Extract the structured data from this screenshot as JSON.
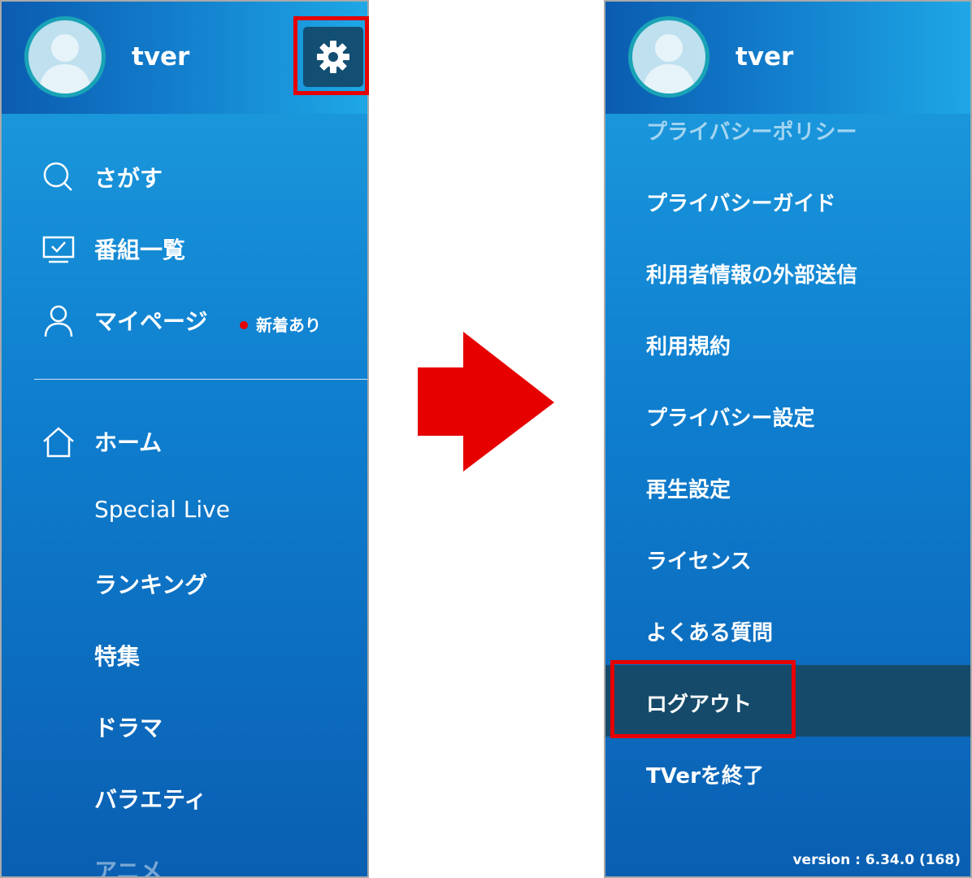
{
  "left": {
    "username": "tver",
    "settings_icon": "gear-icon",
    "nav_items": [
      {
        "label": "さがす",
        "icon": "search-icon"
      },
      {
        "label": "番組一覧",
        "icon": "tv-icon"
      },
      {
        "label": "マイページ",
        "icon": "person-icon",
        "badge": "新着あり"
      }
    ],
    "home": {
      "label": "ホーム",
      "icon": "home-icon"
    },
    "sub_items": [
      "Special Live",
      "ランキング",
      "特集",
      "ドラマ",
      "バラエティ",
      "アニメ"
    ]
  },
  "right": {
    "username": "tver",
    "menu_items": [
      "プライバシーポリシー",
      "プライバシーガイド",
      "利用者情報の外部送信",
      "利用規約",
      "プライバシー設定",
      "再生設定",
      "ライセンス",
      "よくある質問",
      "ログアウト",
      "TVerを終了"
    ],
    "highlighted_item": "ログアウト",
    "version": "version : 6.34.0 (168)"
  },
  "colors": {
    "highlight_red": "#e60000",
    "accent_blue": "#1e9fe0",
    "selected_row": "#154a6a"
  }
}
